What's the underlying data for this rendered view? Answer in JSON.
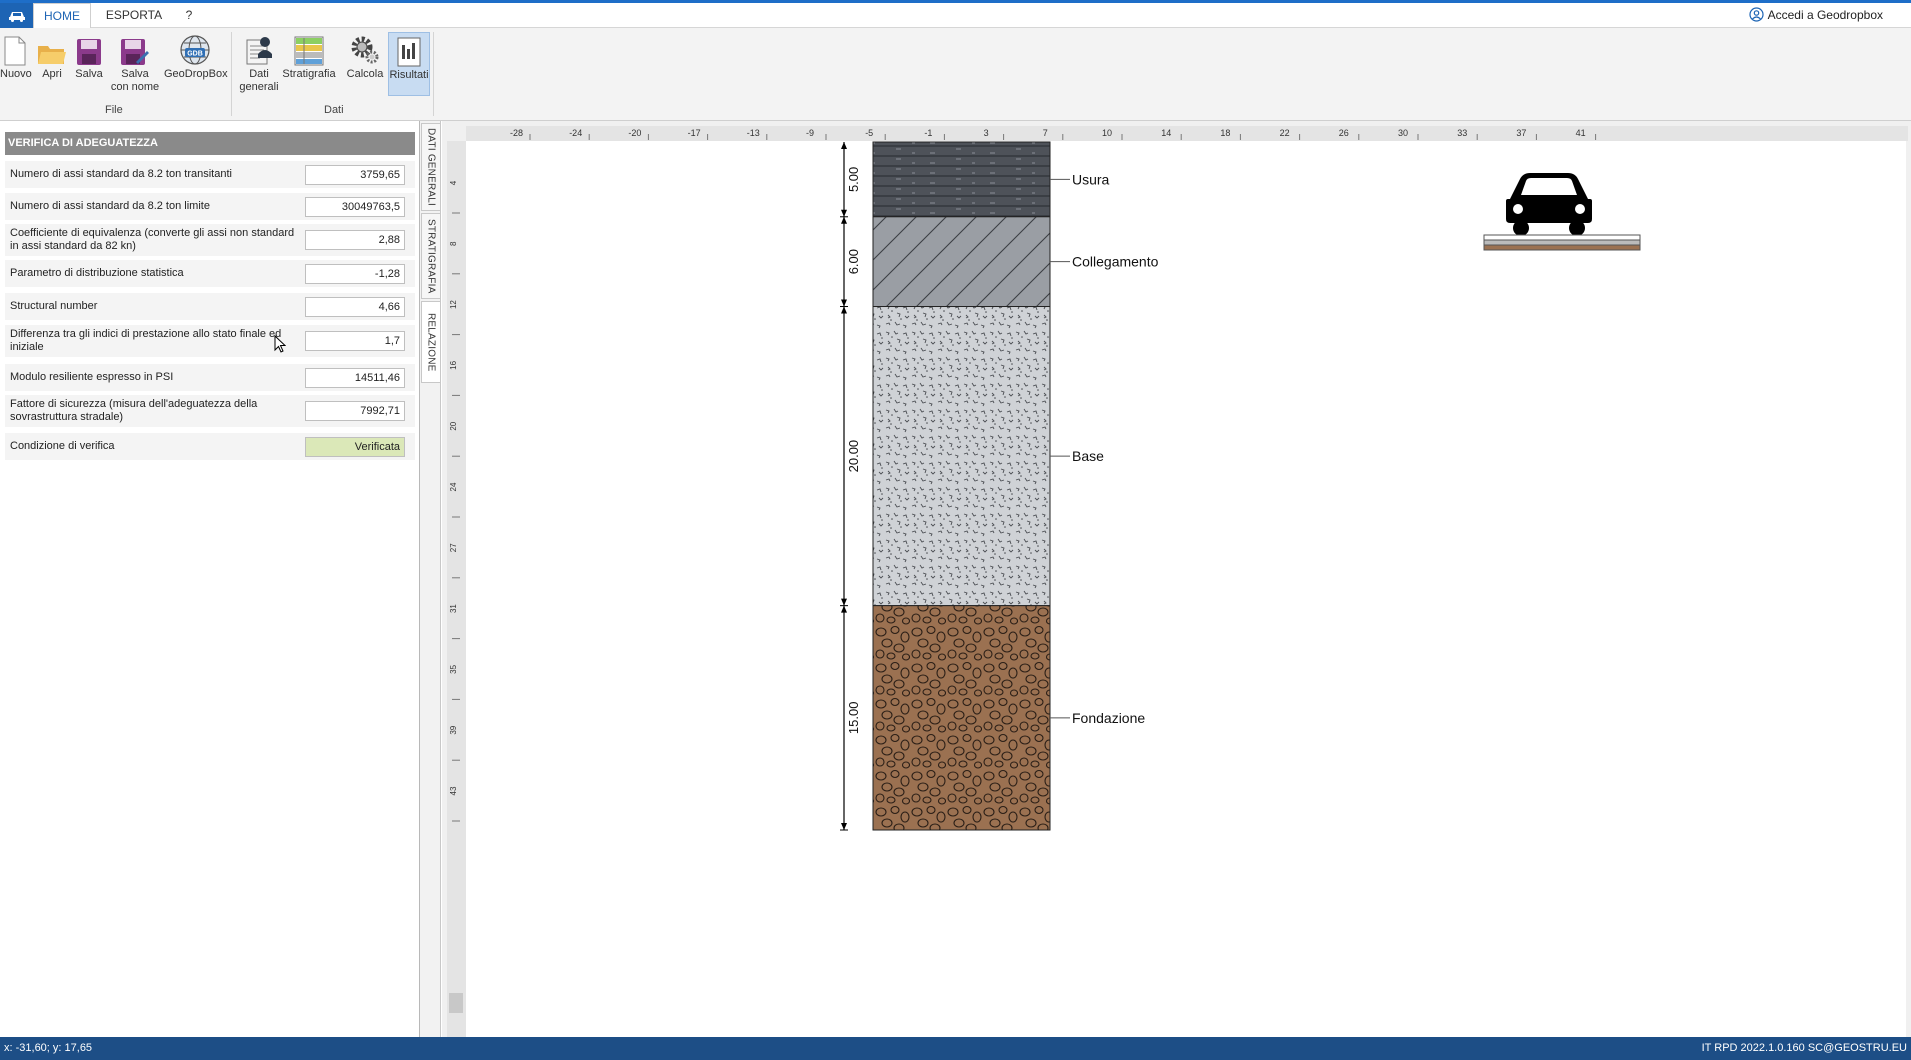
{
  "tabs": {
    "home": "HOME",
    "export": "ESPORTA",
    "help": "?"
  },
  "account": {
    "label": "Accedi a Geodropbox"
  },
  "ribbon": {
    "new": "Nuovo",
    "open": "Apri",
    "save": "Salva",
    "save_as_1": "Salva",
    "save_as_2": "con nome",
    "geodropbox": "GeoDropBox",
    "general_data_1": "Dati",
    "general_data_2": "generali",
    "stratigraphy": "Stratigrafia",
    "calculate": "Calcola",
    "results": "Risultati",
    "group_file": "File",
    "group_data": "Dati"
  },
  "panel": {
    "title": "VERIFICA DI ADEGUATEZZA",
    "rows": [
      {
        "label": "Numero di assi standard da 8.2 ton transitanti",
        "value": "3759,65"
      },
      {
        "label": "Numero di assi standard da 8.2 ton limite",
        "value": "30049763,5"
      },
      {
        "label": "Coefficiente di equivalenza (converte gli assi non standard in assi standard da 82 kn)",
        "value": "2,88"
      },
      {
        "label": "Parametro di distribuzione statistica",
        "value": "-1,28"
      },
      {
        "label": "Structural number",
        "value": "4,66"
      },
      {
        "label": "Differenza tra gli indici di prestazione allo stato finale ed iniziale",
        "value": "1,7"
      },
      {
        "label": "Modulo resiliente espresso in PSI",
        "value": "14511,46"
      },
      {
        "label": "Fattore di sicurezza (misura dell'adeguatezza della sovrastruttura stradale)",
        "value": "7992,71"
      },
      {
        "label": "Condizione di verifica",
        "value": "Verificata"
      }
    ]
  },
  "vertical_tabs": {
    "general": "DATI GENERALI",
    "strat": "STRATIGRAFIA",
    "report": "RELAZIONE"
  },
  "ruler": {
    "h_ticks": [
      "-28",
      "-24",
      "-20",
      "-17",
      "-13",
      "-9",
      "-5",
      "-1",
      "3",
      "7",
      "10",
      "14",
      "18",
      "22",
      "26",
      "30",
      "33",
      "37",
      "41"
    ],
    "v_ticks": [
      "4",
      "8",
      "12",
      "16",
      "20",
      "24",
      "27",
      "31",
      "35",
      "39",
      "43"
    ]
  },
  "layers": [
    {
      "name": "Usura",
      "thickness": "5.00",
      "color": "#4e5259"
    },
    {
      "name": "Collegamento",
      "thickness": "6.00",
      "color": "#9a9ea4"
    },
    {
      "name": "Base",
      "thickness": "20.00",
      "color": "#cfd2d6"
    },
    {
      "name": "Fondazione",
      "thickness": "15.00",
      "color": "#9b7151"
    }
  ],
  "status": {
    "coords": "x: -31,60; y: 17,65",
    "right": "IT  RPD 2022.1.0.160 SC@GEOSTRU.EU"
  }
}
